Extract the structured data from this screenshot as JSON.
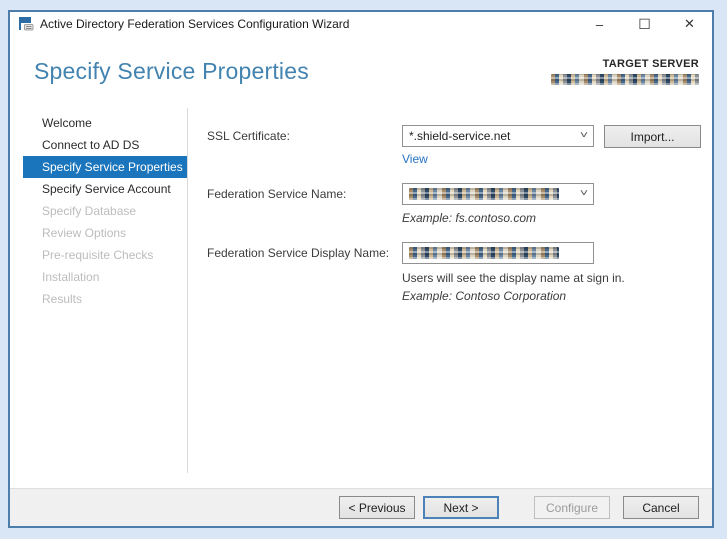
{
  "window": {
    "title": "Active Directory Federation Services Configuration Wizard",
    "icons": {
      "minimize": "–",
      "maximize": "☐",
      "close": "✕",
      "combo_chevron": "˅"
    }
  },
  "header": {
    "page_title": "Specify Service Properties",
    "target_server_label": "TARGET SERVER",
    "target_server_value_redacted": true
  },
  "sidebar": {
    "items": [
      {
        "label": "Welcome",
        "state": "enabled"
      },
      {
        "label": "Connect to AD DS",
        "state": "enabled"
      },
      {
        "label": "Specify Service Properties",
        "state": "active"
      },
      {
        "label": "Specify Service Account",
        "state": "enabled"
      },
      {
        "label": "Specify Database",
        "state": "disabled"
      },
      {
        "label": "Review Options",
        "state": "disabled"
      },
      {
        "label": "Pre-requisite Checks",
        "state": "disabled"
      },
      {
        "label": "Installation",
        "state": "disabled"
      },
      {
        "label": "Results",
        "state": "disabled"
      }
    ]
  },
  "form": {
    "ssl_certificate": {
      "label": "SSL Certificate:",
      "value": "*.shield-service.net",
      "import_button": "Import...",
      "view_link": "View"
    },
    "federation_service_name": {
      "label": "Federation Service Name:",
      "value_redacted": true,
      "example": "Example: fs.contoso.com"
    },
    "federation_service_display_name": {
      "label": "Federation Service Display Name:",
      "value_redacted": true,
      "hint": "Users will see the display name at sign in.",
      "example": "Example: Contoso Corporation"
    }
  },
  "footer": {
    "previous_button": "< Previous",
    "next_button": "Next >",
    "configure_button": "Configure",
    "cancel_button": "Cancel"
  },
  "colors": {
    "accent_selection": "#1b75bc",
    "page_title": "#4383b0",
    "link": "#2673c2",
    "window_border": "#4d7dab",
    "desktop_background": "#d9e6f5",
    "footer_background": "#f0f0f0"
  }
}
